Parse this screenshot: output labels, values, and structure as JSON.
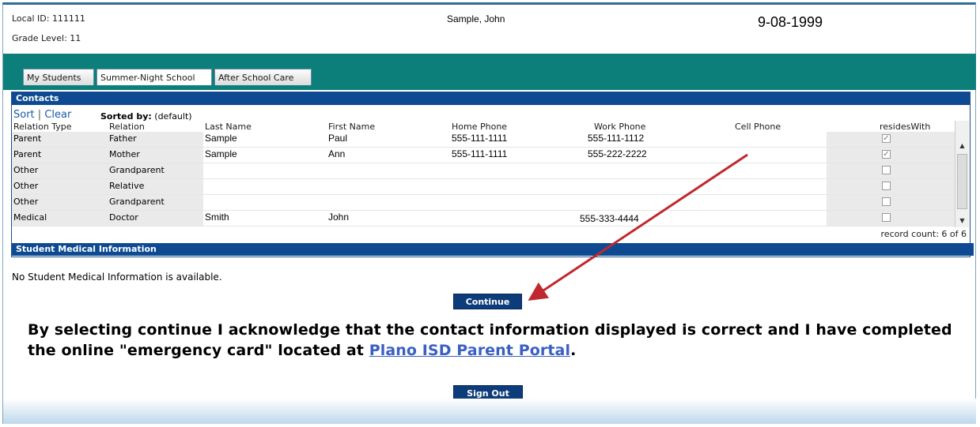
{
  "header": {
    "local_id_label": "Local ID:",
    "local_id": "111111",
    "grade_label": "Grade Level:",
    "grade": "11",
    "student_name": "Sample, John",
    "birth_date": "9-08-1999"
  },
  "tabs": [
    {
      "label": "My Students",
      "active": false
    },
    {
      "label": "Summer-Night School",
      "active": true
    },
    {
      "label": "After School Care",
      "active": false
    }
  ],
  "contacts": {
    "title": "Contacts",
    "sort_label": "Sort",
    "clear_label": "Clear",
    "separator": "|",
    "sorted_by_label": "Sorted by:",
    "sorted_by_value": "(default)",
    "columns": [
      "Relation Type",
      "Relation",
      "Last Name",
      "First Name",
      "Home Phone",
      "Work Phone",
      "Cell Phone",
      "residesWith"
    ],
    "rows": [
      {
        "relation_type": "Parent",
        "relation": "Father",
        "last_name": "Sample",
        "first_name": "Paul",
        "home_phone": "555-111-1111",
        "work_phone": "555-111-1112",
        "cell_phone": "",
        "resides_with": true
      },
      {
        "relation_type": "Parent",
        "relation": "Mother",
        "last_name": "Sample",
        "first_name": "Ann",
        "home_phone": "555-111-1111",
        "work_phone": "555-222-2222",
        "cell_phone": "",
        "resides_with": true
      },
      {
        "relation_type": "Other",
        "relation": "Grandparent",
        "last_name": "",
        "first_name": "",
        "home_phone": "",
        "work_phone": "",
        "cell_phone": "",
        "resides_with": false
      },
      {
        "relation_type": "Other",
        "relation": "Relative",
        "last_name": "",
        "first_name": "",
        "home_phone": "",
        "work_phone": "",
        "cell_phone": "",
        "resides_with": false
      },
      {
        "relation_type": "Other",
        "relation": "Grandparent",
        "last_name": "",
        "first_name": "",
        "home_phone": "",
        "work_phone": "",
        "cell_phone": "",
        "resides_with": false
      },
      {
        "relation_type": "Medical",
        "relation": "Doctor",
        "last_name": "Smith",
        "first_name": "John",
        "home_phone": "",
        "work_phone": "555-333-4444",
        "cell_phone": "",
        "resides_with": false
      }
    ],
    "record_count": "record count: 6 of 6"
  },
  "medical": {
    "title": "Student Medical Information",
    "message": "No Student Medical Information is available."
  },
  "buttons": {
    "continue": "Continue",
    "sign_out": "Sign Out"
  },
  "acknowledgement": {
    "text": "By selecting continue I acknowledge that the contact information displayed is correct and I have completed the online \"emergency card\" located at ",
    "link": "Plano ISD Parent Portal",
    "end": "."
  },
  "colors": {
    "teal_band": "#0c7f7b",
    "header_bar": "#0d4a92",
    "button": "#0d3c7a",
    "annotation_arrow": "#c0282d",
    "link": "#3a5fc4"
  },
  "icons": {
    "check": "✓",
    "scroll_up": "▲",
    "scroll_down": "▼"
  }
}
